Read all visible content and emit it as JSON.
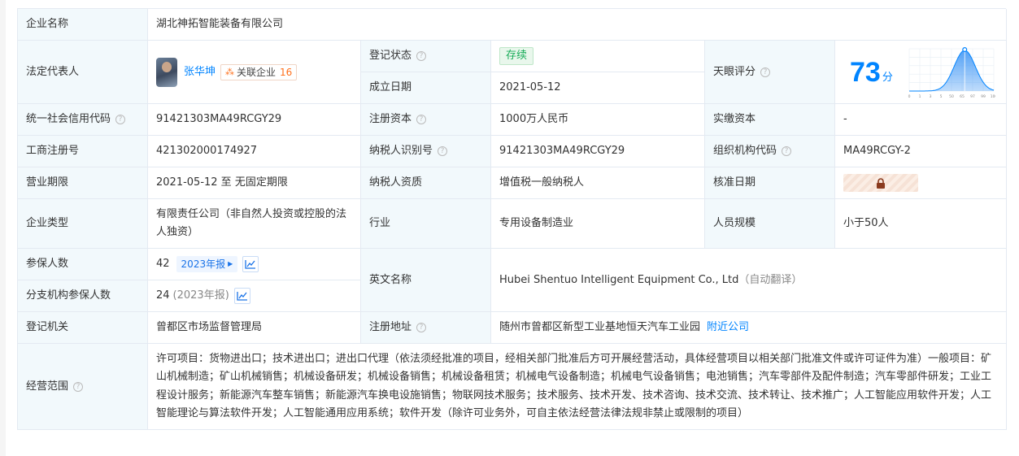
{
  "company": {
    "label": "企业名称",
    "value": "湖北神拓智能装备有限公司"
  },
  "legal_rep": {
    "label": "法定代表人",
    "name": "张华坤",
    "related_label": "关联企业",
    "related_count": "16"
  },
  "reg_status": {
    "label": "登记状态",
    "value": "存续"
  },
  "established": {
    "label": "成立日期",
    "value": "2021-05-12"
  },
  "tianyan_score": {
    "label": "天眼评分",
    "value": "73",
    "unit": "分",
    "chart_data": {
      "type": "area",
      "x": [
        0,
        1,
        3,
        5,
        50,
        65,
        97,
        99,
        100
      ],
      "xticks": [
        "0",
        "1",
        "3",
        "5",
        "50",
        "65",
        "97",
        "99",
        "100"
      ],
      "marker": 73,
      "colors": {
        "fill": "#4a9cf5",
        "line": "#0084ff"
      }
    }
  },
  "credit_code": {
    "label": "统一社会信用代码",
    "value": "91421303MA49RCGY29"
  },
  "reg_capital": {
    "label": "注册资本",
    "value": "1000万人民币"
  },
  "paid_capital": {
    "label": "实缴资本",
    "value": "-"
  },
  "biz_reg_no": {
    "label": "工商注册号",
    "value": "421302000174927"
  },
  "taxpayer_id": {
    "label": "纳税人识别号",
    "value": "91421303MA49RCGY29"
  },
  "org_code": {
    "label": "组织机构代码",
    "value": "MA49RCGY-2"
  },
  "biz_term": {
    "label": "营业期限",
    "value": "2021-05-12 至 无固定期限"
  },
  "taxpayer_qual": {
    "label": "纳税人资质",
    "value": "增值税一般纳税人"
  },
  "approval_date": {
    "label": "核准日期"
  },
  "company_type": {
    "label": "企业类型",
    "value": "有限责任公司（非自然人投资或控股的法人独资）"
  },
  "industry": {
    "label": "行业",
    "value": "专用设备制造业"
  },
  "staff_size": {
    "label": "人员规模",
    "value": "小于50人"
  },
  "insured": {
    "label": "参保人数",
    "value": "42",
    "year_tag": "2023年报"
  },
  "branch_insured": {
    "label": "分支机构参保人数",
    "value": "24",
    "year_note": "(2023年报)"
  },
  "english_name": {
    "label": "英文名称",
    "value": "Hubei Shentuo Intelligent Equipment Co., Ltd",
    "note": "（自动翻译）"
  },
  "reg_authority": {
    "label": "登记机关",
    "value": "曾都区市场监督管理局"
  },
  "reg_address": {
    "label": "注册地址",
    "value": "随州市曾都区新型工业基地恒天汽车工业园",
    "nearby": "附近公司"
  },
  "biz_scope": {
    "label": "经营范围",
    "value": "许可项目：货物进出口；技术进出口；进出口代理（依法须经批准的项目，经相关部门批准后方可开展经营活动，具体经营项目以相关部门批准文件或许可证件为准）一般项目：矿山机械制造；矿山机械销售；机械设备研发；机械设备销售；机械设备租赁；机械电气设备制造；机械电气设备销售；电池销售；汽车零部件及配件制造；汽车零部件研发；工业工程设计服务；新能源汽车整车销售；新能源汽车换电设施销售；物联网技术服务；技术服务、技术开发、技术咨询、技术交流、技术转让、技术推广；人工智能应用软件开发；人工智能理论与算法软件开发；人工智能通用应用系统；软件开发（除许可业务外，可自主依法经营法律法规非禁止或限制的项目）"
  }
}
